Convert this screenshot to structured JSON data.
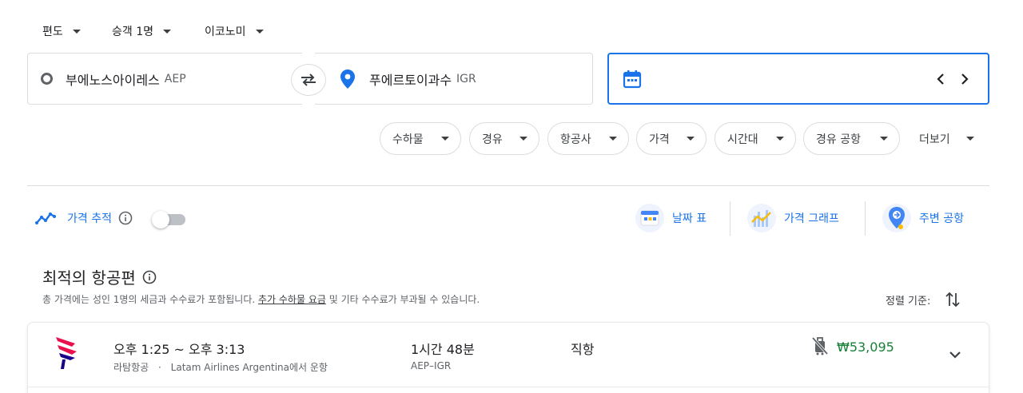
{
  "top_selectors": {
    "trip_type": "편도",
    "passengers": "승객 1명",
    "cabin_class": "이코노미"
  },
  "search": {
    "origin_city": "부에노스아이레스",
    "origin_code": "AEP",
    "destination_city": "푸에르토이과수",
    "destination_code": "IGR",
    "date_value": ""
  },
  "filters": {
    "bags": "수하물",
    "stops": "경유",
    "airlines": "항공사",
    "price": "가격",
    "times": "시간대",
    "connecting_airports": "경유 공항",
    "more": "더보기"
  },
  "tracking": {
    "label": "가격 추적",
    "enabled": false
  },
  "tools": {
    "date_grid": "날짜 표",
    "price_graph": "가격 그래프",
    "nearby_airports": "주변 공항"
  },
  "best": {
    "title": "최적의 항공편",
    "subtext_before": "총 가격에는 성인 1명의 세금과 수수료가 포함됩니다. ",
    "subtext_link": "추가 수하물 요금",
    "subtext_after": " 및 기타 수수료가 부과될 수 있습니다.",
    "sort_label": "정렬 기준:"
  },
  "flight": {
    "times": "오후 1:25 ~ 오후 3:13",
    "airline": "라탐항공",
    "separator": "·",
    "operated_by": "Latam Airlines Argentina에서 운항",
    "duration": "1시간 48분",
    "route": "AEP–IGR",
    "stops": "직항",
    "price": "₩53,095"
  },
  "colors": {
    "accent": "#1a73e8",
    "price_green": "#188038",
    "border": "#dadce0",
    "latam_red": "#e8114b",
    "latam_navy": "#1b0088"
  }
}
